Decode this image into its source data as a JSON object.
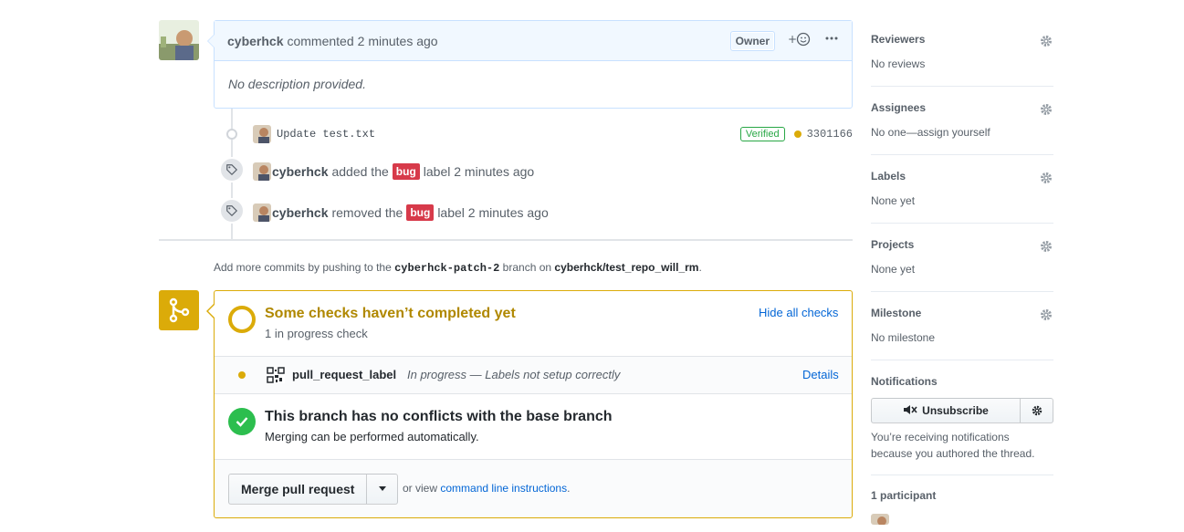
{
  "comment": {
    "author": "cyberhck",
    "action": "commented",
    "time": "2 minutes ago",
    "badge": "Owner",
    "reaction_icon": "smiley-add-icon",
    "more_icon": "kebab-horizontal-icon",
    "body": "No description provided."
  },
  "timeline": {
    "commit": {
      "message": "Update test.txt",
      "verified": "Verified",
      "sha": "3301166",
      "status_color": "#dbab09"
    },
    "events": [
      {
        "actor": "cyberhck",
        "before": "added the",
        "label": "bug",
        "after": "label 2 minutes ago"
      },
      {
        "actor": "cyberhck",
        "before": "removed the",
        "label": "bug",
        "after": "label 2 minutes ago"
      }
    ]
  },
  "push_note": {
    "prefix": "Add more commits by pushing to the",
    "branch": "cyberhck-patch-2",
    "middle": "branch on",
    "repo": "cyberhck/test_repo_will_rm",
    "suffix": "."
  },
  "checks": {
    "title": "Some checks haven’t completed yet",
    "subtitle": "1 in progress check",
    "toggle": "Hide all checks",
    "item": {
      "name": "pull_request_label",
      "status": "In progress — Labels not setup correctly",
      "details": "Details"
    }
  },
  "conflicts": {
    "title": "This branch has no conflicts with the base branch",
    "subtitle": "Merging can be performed automatically."
  },
  "merge": {
    "button": "Merge pull request",
    "alt_prefix": "or view",
    "alt_link": "command line instructions",
    "alt_suffix": "."
  },
  "sidebar": {
    "reviewers": {
      "title": "Reviewers",
      "value": "No reviews"
    },
    "assignees": {
      "title": "Assignees",
      "value": "No one—assign yourself"
    },
    "labels": {
      "title": "Labels",
      "value": "None yet"
    },
    "projects": {
      "title": "Projects",
      "value": "None yet"
    },
    "milestone": {
      "title": "Milestone",
      "value": "No milestone"
    },
    "notifications": {
      "title": "Notifications",
      "button": "Unsubscribe",
      "reason": "You’re receiving notifications because you authored the thread."
    },
    "participants": {
      "title": "1 participant"
    }
  },
  "colors": {
    "accent_yellow": "#dbab09",
    "success_green": "#2cbe4e",
    "label_bug": "#d73a4a",
    "link_blue": "#0366d6"
  }
}
